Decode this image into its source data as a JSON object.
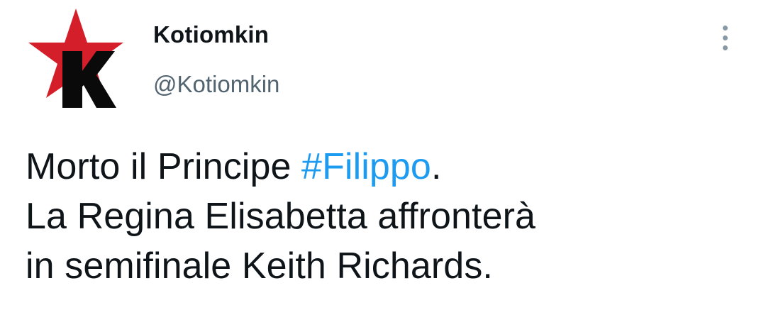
{
  "author": {
    "display_name": "Kotiomkin",
    "handle": "@Kotiomkin",
    "avatar_icon": "red-star-k-logo-icon"
  },
  "menu": {
    "icon": "more-options-vertical-icon"
  },
  "tweet": {
    "line1_pre": "Morto il Principe ",
    "line1_hashtag": "#Filippo",
    "line1_post": ".",
    "line2": "La Regina Elisabetta affronterà",
    "line3": "in semifinale Keith Richards."
  },
  "colors": {
    "text": "#0f1419",
    "handle": "#536471",
    "hashtag": "#1d9bf0",
    "star": "#d41f2a",
    "logo_letter": "#0a0a0a"
  }
}
